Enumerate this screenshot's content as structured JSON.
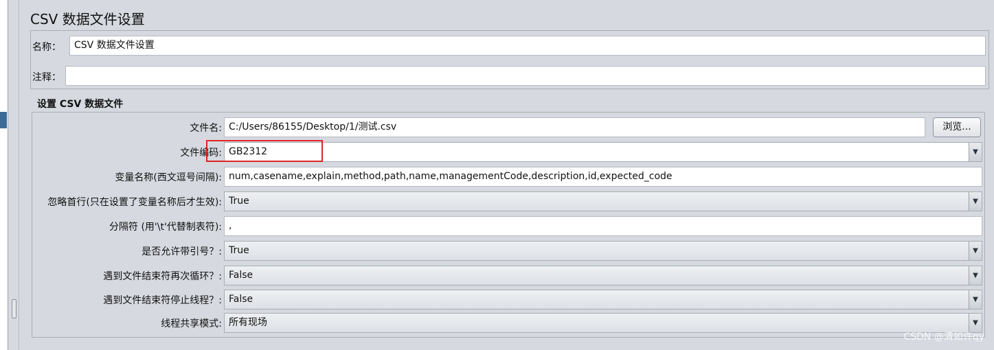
{
  "title": "CSV 数据文件设置",
  "name_label": "名称：",
  "name_value": "CSV 数据文件设置",
  "comment_label": "注释：",
  "comment_value": "",
  "section_title": "设置 CSV 数据文件",
  "browse_label": "浏览...",
  "fields": {
    "filename": {
      "label": "文件名:",
      "value": "C:/Users/86155/Desktop/1/测试.csv"
    },
    "encoding": {
      "label": "文件编码:",
      "value": "GB2312"
    },
    "varnames": {
      "label": "变量名称(西文逗号间隔):",
      "value": "num,casename,explain,method,path,name,managementCode,description,id,expected_code"
    },
    "ignore_first_line": {
      "label": "忽略首行(只在设置了变量名称后才生效):",
      "value": "True"
    },
    "delimiter": {
      "label": "分隔符 (用'\\t'代替制表符):",
      "value": ","
    },
    "quoted_data": {
      "label": "是否允许带引号？:",
      "value": "True"
    },
    "recycle": {
      "label": "遇到文件结束符再次循环？:",
      "value": "False"
    },
    "stop_thread": {
      "label": "遇到文件结束符停止线程？:",
      "value": "False"
    },
    "share_mode": {
      "label": "线程共享模式:",
      "value": "所有现场"
    }
  },
  "watermark": "CSDN @清如许qy",
  "colors": {
    "highlight": "#e02424",
    "marker": "#3a6b96"
  }
}
